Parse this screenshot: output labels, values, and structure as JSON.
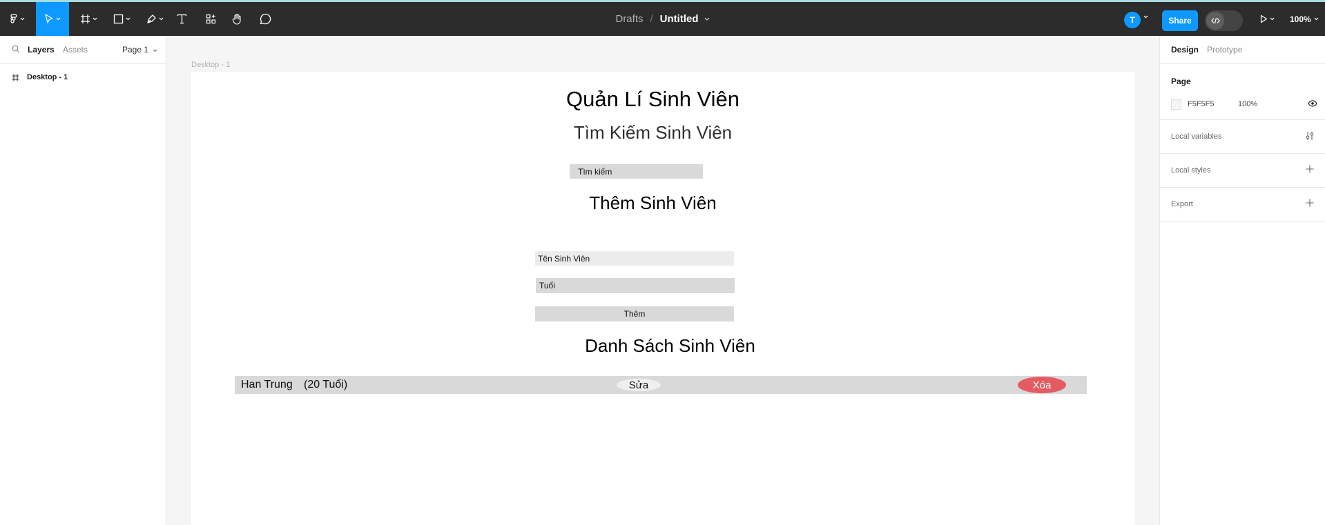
{
  "toolbar": {
    "breadcrumb_parent": "Drafts",
    "breadcrumb_sep": "/",
    "file_name": "Untitled",
    "avatar_initial": "T",
    "share_label": "Share",
    "zoom": "100%"
  },
  "left_panel": {
    "tabs": [
      "Layers",
      "Assets"
    ],
    "page_selector": "Page 1",
    "layers": [
      {
        "label": "Desktop - 1",
        "icon": "frame-icon"
      }
    ]
  },
  "canvas": {
    "frame_label": "Desktop - 1",
    "app": {
      "title": "Quản Lí Sinh Viên",
      "search_heading": "Tìm Kiếm Sinh Viên",
      "search_placeholder": "Tìm kiếm",
      "add_heading": "Thêm Sinh Viên",
      "name_placeholder": "Tên Sinh Viên",
      "age_placeholder": "Tuổi",
      "add_button": "Thêm",
      "list_heading": "Danh Sách Sinh Viên",
      "students": [
        {
          "name": "Han Trung",
          "age": "(20 Tuổi)",
          "edit_label": "Sửa",
          "delete_label": "Xóa"
        }
      ]
    }
  },
  "right_panel": {
    "tabs": [
      "Design",
      "Prototype"
    ],
    "page_section": {
      "heading": "Page",
      "fill_hex": "F5F5F5",
      "opacity": "100%"
    },
    "sections": [
      "Local variables",
      "Local styles",
      "Export"
    ]
  },
  "colors": {
    "toolbar_bg": "#2c2c2c",
    "accent_blue": "#0d99ff",
    "delete_red": "#e45b61",
    "canvas_bg": "#f5f5f5",
    "input_gray": "#d9d9d9"
  }
}
